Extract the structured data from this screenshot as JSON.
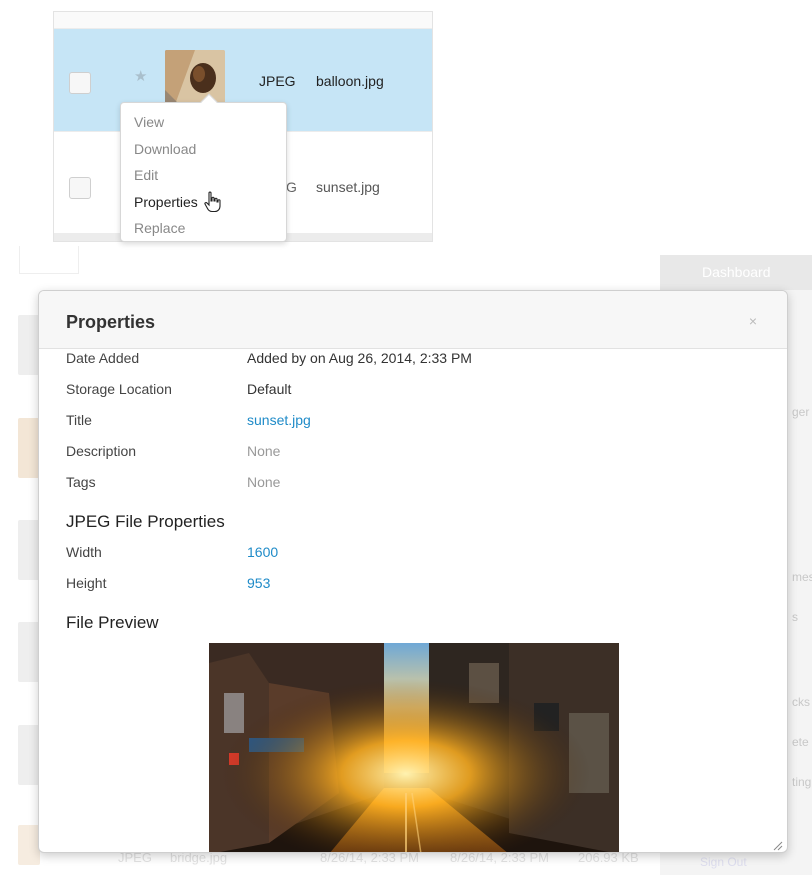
{
  "file_list": {
    "rows": [
      {
        "type": "JPEG",
        "filename": "balloon.jpg",
        "selected": true
      },
      {
        "type": "G",
        "filename": "sunset.jpg",
        "selected": false
      }
    ],
    "context_menu": [
      "View",
      "Download",
      "Edit",
      "Properties",
      "Replace"
    ]
  },
  "background": {
    "sidebar_title": "Dashboard",
    "sidebar_fragments": [
      "ger",
      "mes",
      "s",
      "cks",
      "ete",
      "ting"
    ],
    "sign_out": "Sign Out",
    "bottom_row": {
      "type": "JPEG",
      "filename": "bridge.jpg",
      "date_added": "8/26/14, 2:33 PM",
      "date_modified": "8/26/14, 2:33 PM",
      "size": "206.93 KB"
    }
  },
  "modal": {
    "title": "Properties",
    "close": "×",
    "properties": [
      {
        "label": "Date Added",
        "value": "Added by on Aug 26, 2014, 2:33 PM",
        "style": "dark"
      },
      {
        "label": "Storage Location",
        "value": "Default",
        "style": "dark"
      },
      {
        "label": "Title",
        "value": "sunset.jpg",
        "style": "link"
      },
      {
        "label": "Description",
        "value": "None",
        "style": "muted"
      },
      {
        "label": "Tags",
        "value": "None",
        "style": "muted"
      }
    ],
    "jpeg_heading": "JPEG File Properties",
    "jpeg_properties": [
      {
        "label": "Width",
        "value": "1600"
      },
      {
        "label": "Height",
        "value": "953"
      }
    ],
    "preview_heading": "File Preview",
    "preview_image": "sunset street photo"
  },
  "colors": {
    "selected_row": "#c6e5f6",
    "link": "#1f8bc8",
    "muted": "#999999"
  }
}
